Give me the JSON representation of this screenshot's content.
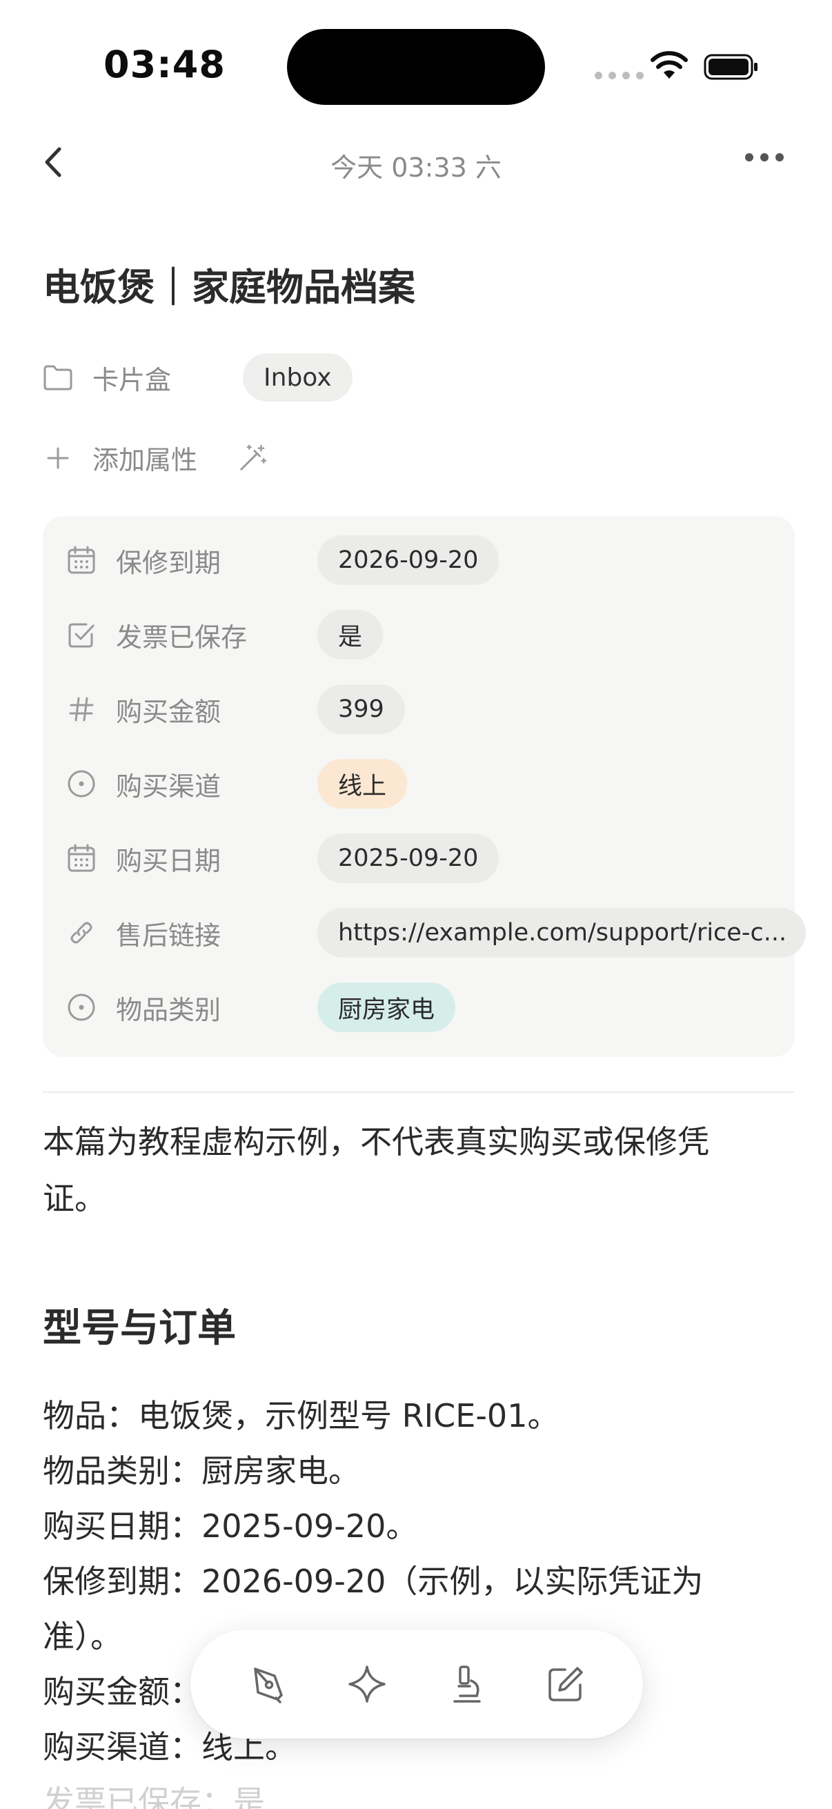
{
  "status_bar": {
    "time": "03:48"
  },
  "nav": {
    "title": "今天 03:33 六"
  },
  "doc": {
    "title": "电饭煲｜家庭物品档案"
  },
  "meta": {
    "folder_label": "卡片盒",
    "folder_value": "Inbox",
    "add_property_label": "添加属性"
  },
  "properties": [
    {
      "label": "保修到期",
      "value": "2026-09-20",
      "icon": "calendar-icon"
    },
    {
      "label": "发票已保存",
      "value": "是",
      "icon": "checkbox-icon"
    },
    {
      "label": "购买金额",
      "value": "399",
      "icon": "hash-icon"
    },
    {
      "label": "购买渠道",
      "value": "线上",
      "icon": "select-icon",
      "color": "#fbe7d2"
    },
    {
      "label": "购买日期",
      "value": "2025-09-20",
      "icon": "calendar-icon"
    },
    {
      "label": "售后链接",
      "value": "https://example.com/support/rice-c...",
      "icon": "link-icon"
    },
    {
      "label": "物品类别",
      "value": "厨房家电",
      "icon": "select-icon",
      "color": "#d6eeea"
    }
  ],
  "body": {
    "intro_line1": "本篇为教程虚构示例，不代表真实购买或保修凭",
    "intro_line2": "证。",
    "heading": "型号与订单",
    "lines": [
      "物品：电饭煲，示例型号 RICE-01。",
      "物品类别：厨房家电。",
      "购买日期：2025-09-20。",
      "保修到期：2026-09-20（示例，以实际凭证为",
      "准）。",
      "购买金额：",
      "购买渠道：线上。",
      "发票已保存：是"
    ]
  },
  "toolbar": {
    "tools": [
      "pen-icon",
      "sparkle-icon",
      "microscope-icon",
      "edit-icon"
    ]
  }
}
